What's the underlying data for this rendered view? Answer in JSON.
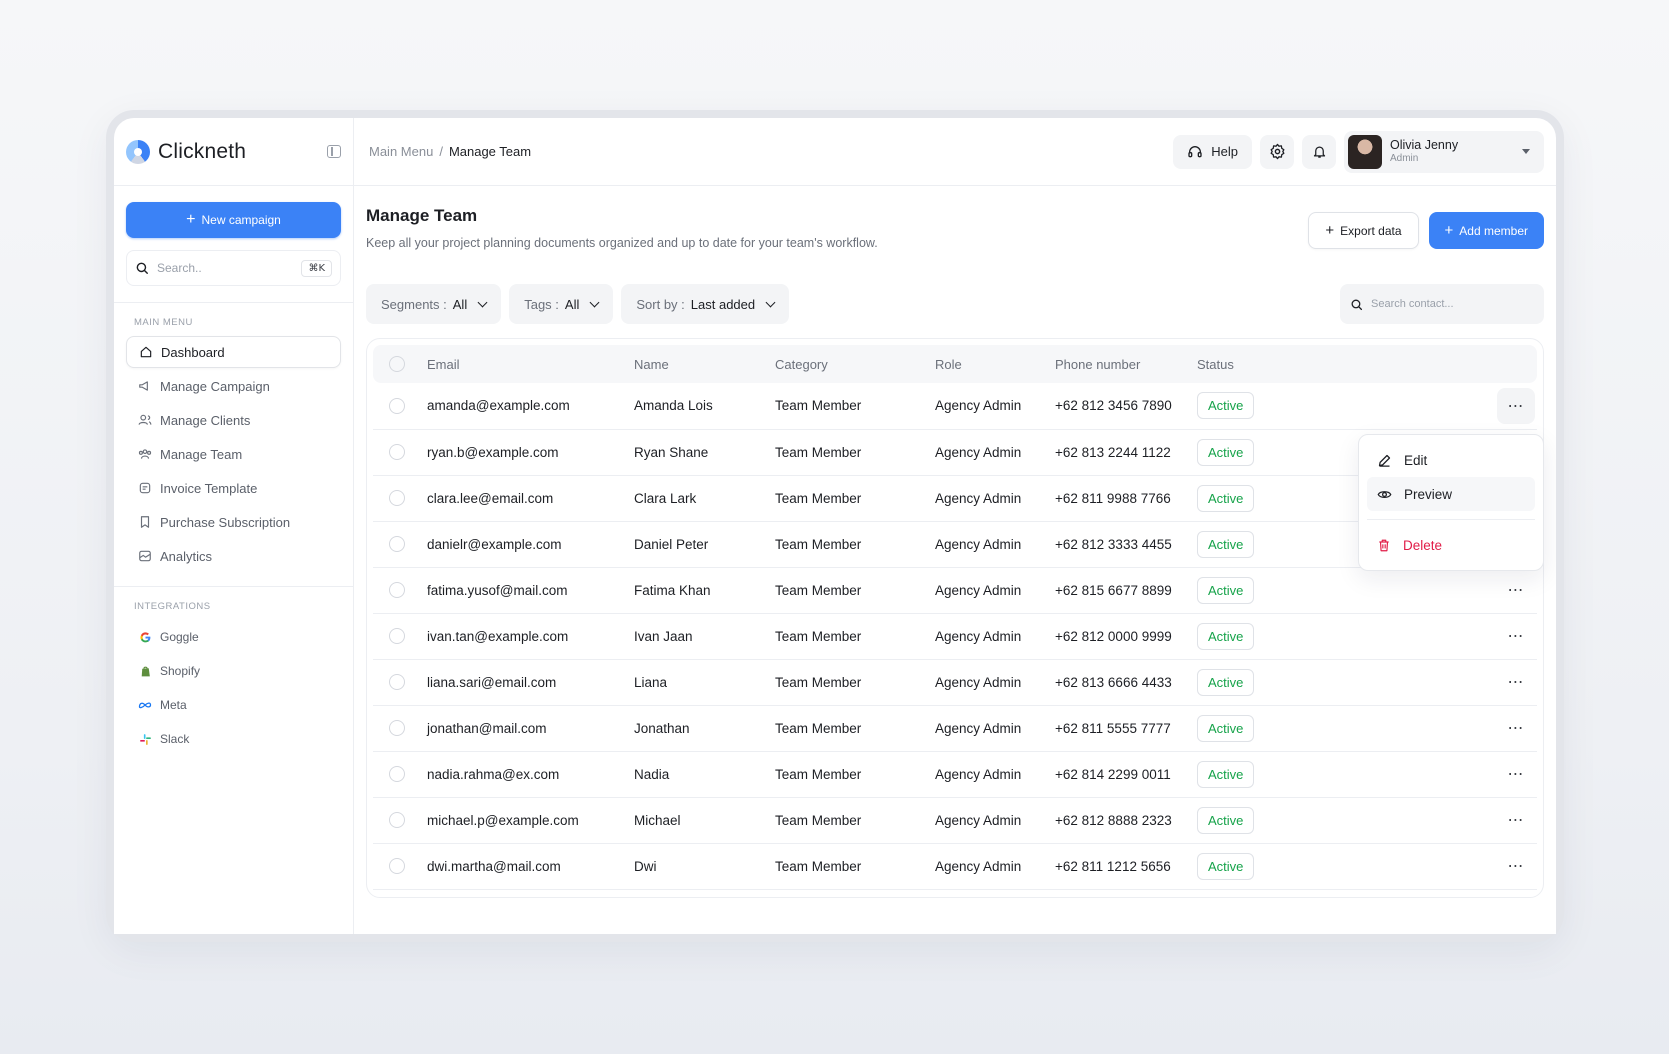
{
  "app": {
    "name": "Clickneth"
  },
  "sidebar": {
    "new_campaign": "New campaign",
    "search_placeholder": "Search..",
    "search_shortcut": "⌘K",
    "main_menu_label": "MAIN MENU",
    "items": [
      {
        "label": "Dashboard",
        "icon": "home-icon",
        "active": true
      },
      {
        "label": "Manage Campaign",
        "icon": "megaphone-icon"
      },
      {
        "label": "Manage Clients",
        "icon": "users-icon"
      },
      {
        "label": "Manage Team",
        "icon": "team-icon"
      },
      {
        "label": "Invoice Template",
        "icon": "invoice-icon"
      },
      {
        "label": "Purchase Subscription",
        "icon": "bookmark-icon"
      },
      {
        "label": "Analytics",
        "icon": "analytics-icon"
      }
    ],
    "integrations_label": "INTEGRATIONS",
    "integrations": [
      {
        "label": "Goggle",
        "icon": "google-icon"
      },
      {
        "label": "Shopify",
        "icon": "shopify-icon"
      },
      {
        "label": "Meta",
        "icon": "meta-icon"
      },
      {
        "label": "Slack",
        "icon": "slack-icon"
      }
    ]
  },
  "topbar": {
    "breadcrumb_root": "Main Menu",
    "breadcrumb_sep": "/",
    "breadcrumb_current": "Manage Team",
    "help": "Help",
    "user_name": "Olivia Jenny",
    "user_role": "Admin"
  },
  "page": {
    "title": "Manage Team",
    "subtitle": "Keep all your project planning documents organized and up to date for your team's workflow.",
    "export": "Export data",
    "add_member": "Add member"
  },
  "filters": {
    "segments_label": "Segments :",
    "segments_value": "All",
    "tags_label": "Tags :",
    "tags_value": "All",
    "sort_label": "Sort by :",
    "sort_value": "Last added",
    "search_placeholder": "Search contact..."
  },
  "table": {
    "headers": [
      "Email",
      "Name",
      "Category",
      "Role",
      "Phone number",
      "Status"
    ],
    "rows": [
      {
        "email": "amanda@example.com",
        "name": "Amanda Lois",
        "category": "Team Member",
        "role": "Agency Admin",
        "phone": "+62 812 3456 7890",
        "status": "Active"
      },
      {
        "email": "ryan.b@example.com",
        "name": "Ryan Shane",
        "category": "Team Member",
        "role": "Agency Admin",
        "phone": "+62 813 2244 1122",
        "status": "Active"
      },
      {
        "email": "clara.lee@email.com",
        "name": "Clara Lark",
        "category": "Team Member",
        "role": "Agency Admin",
        "phone": "+62 811 9988 7766",
        "status": "Active"
      },
      {
        "email": "danielr@example.com",
        "name": "Daniel Peter",
        "category": "Team Member",
        "role": "Agency Admin",
        "phone": "+62 812 3333 4455",
        "status": "Active"
      },
      {
        "email": "fatima.yusof@mail.com",
        "name": "Fatima Khan",
        "category": "Team Member",
        "role": "Agency Admin",
        "phone": "+62 815 6677 8899",
        "status": "Active"
      },
      {
        "email": "ivan.tan@example.com",
        "name": "Ivan Jaan",
        "category": "Team Member",
        "role": "Agency Admin",
        "phone": "+62 812 0000 9999",
        "status": "Active"
      },
      {
        "email": "liana.sari@email.com",
        "name": "Liana",
        "category": "Team Member",
        "role": "Agency Admin",
        "phone": "+62 813 6666 4433",
        "status": "Active"
      },
      {
        "email": "jonathan@mail.com",
        "name": "Jonathan",
        "category": "Team Member",
        "role": "Agency Admin",
        "phone": "+62 811 5555 7777",
        "status": "Active"
      },
      {
        "email": "nadia.rahma@ex.com",
        "name": "Nadia",
        "category": "Team Member",
        "role": "Agency Admin",
        "phone": "+62 814 2299 0011",
        "status": "Active"
      },
      {
        "email": "michael.p@example.com",
        "name": "Michael",
        "category": "Team Member",
        "role": "Agency Admin",
        "phone": "+62 812 8888 2323",
        "status": "Active"
      },
      {
        "email": "dwi.martha@mail.com",
        "name": "Dwi",
        "category": "Team Member",
        "role": "Agency Admin",
        "phone": "+62 811 1212 5656",
        "status": "Active"
      }
    ]
  },
  "row_menu": {
    "edit": "Edit",
    "preview": "Preview",
    "delete": "Delete"
  },
  "colors": {
    "primary": "#3b82f6",
    "active_status": "#16a34a",
    "danger": "#e11d48"
  }
}
